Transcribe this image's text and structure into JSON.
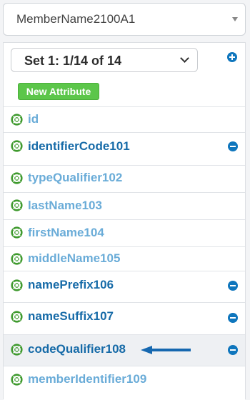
{
  "top_select": {
    "value": "MemberName2100A1"
  },
  "set_select": {
    "value": "Set 1: 1/14 of 14"
  },
  "new_attribute_label": "New Attribute",
  "attributes": [
    {
      "label": "id"
    },
    {
      "label": "identifierCode101"
    },
    {
      "label": "typeQualifier102"
    },
    {
      "label": "lastName103"
    },
    {
      "label": "firstName104"
    },
    {
      "label": "middleName105"
    },
    {
      "label": "namePrefix106"
    },
    {
      "label": "nameSuffix107"
    },
    {
      "label": "codeQualifier108"
    },
    {
      "label": "memberIdentifier109"
    }
  ],
  "colors": {
    "accent_blue": "#0f76bd",
    "link_dark": "#176ba8",
    "link_light": "#6aacd8",
    "green_button": "#5cc64a",
    "icon_green": "#3f9a2e"
  },
  "icons": [
    "chevron-down-icon",
    "plus-circle-icon",
    "minus-circle-icon",
    "lifebuoy-icon",
    "arrow-left-icon"
  ]
}
